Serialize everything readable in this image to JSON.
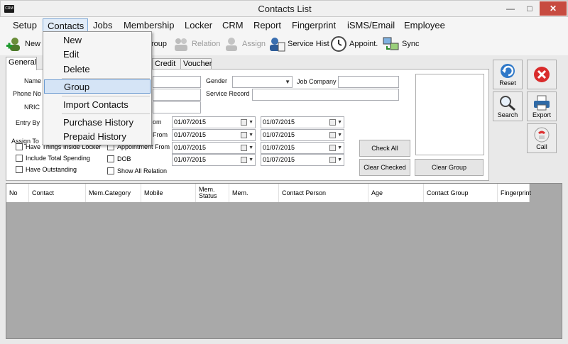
{
  "window": {
    "title": "Contacts List",
    "icon_text": "CRM"
  },
  "menubar": {
    "items": [
      "Setup",
      "Contacts",
      "Jobs",
      "Membership",
      "Locker",
      "CRM",
      "Report",
      "Fingerprint",
      "iSMS/Email",
      "Employee"
    ]
  },
  "contacts_menu": {
    "items": [
      "New",
      "Edit",
      "Delete",
      "Group",
      "Import Contacts",
      "Purchase History",
      "Prepaid History"
    ],
    "selected": "Group"
  },
  "toolbar": {
    "new": "New",
    "group": "roup",
    "relation": "Relation",
    "assign": "Assign",
    "service_hist": "Service Hist",
    "appoint": "Appoint.",
    "sync": "Sync"
  },
  "tabs": [
    "General",
    "Credit",
    "Voucher"
  ],
  "form": {
    "name_label": "Name",
    "phone_label": "Phone No",
    "nric_label": "NRIC",
    "entry_by_label": "Entry By",
    "assign_to_label": "Assign To",
    "gender_label": "Gender",
    "job_company_label": "Job Company",
    "service_record_label": "Service Record",
    "date_label_1": "om",
    "date_label_2": "From",
    "date_label_3": "Appointment From",
    "date_label_4": "DOB",
    "date_1a": "01/07/2015",
    "date_1b": "01/07/2015",
    "date_2a": "01/07/2015",
    "date_2b": "01/07/2015",
    "date_3a": "01/07/2015",
    "date_3b": "01/07/2015",
    "date_4a": "01/07/2015",
    "date_4b": "01/07/2015",
    "chk_locker": "Have Things Inside Locker",
    "chk_spending": "Include Total Spending",
    "chk_outstanding": "Have Outstanding",
    "chk_show_all": "Show All Relation",
    "check_all": "Check All",
    "clear_checked": "Clear Checked",
    "clear_group": "Clear Group"
  },
  "right_buttons": {
    "reset": "Reset",
    "search": "Search",
    "export": "Export",
    "call": "Call"
  },
  "grid": {
    "columns": [
      "No",
      "Contact",
      "Mem.Category",
      "Mobile",
      "Mem. Status",
      "Mem.",
      "Contact Person",
      "Age",
      "Contact Group",
      "Fingerprint"
    ]
  },
  "colors": {
    "close_button": "#c74b40",
    "selected_menu": "#d5e4f6",
    "grid_background": "#a9a9a9"
  }
}
